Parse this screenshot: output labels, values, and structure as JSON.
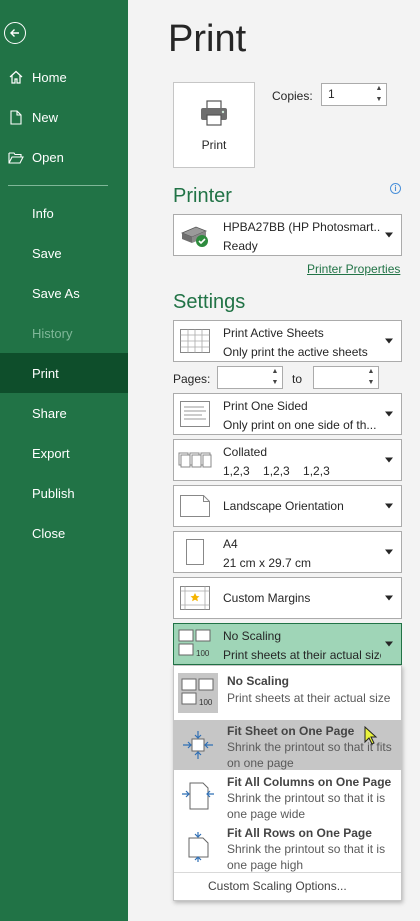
{
  "sidebar": {
    "items": [
      {
        "label": "Home"
      },
      {
        "label": "New"
      },
      {
        "label": "Open"
      },
      {
        "label": "Info"
      },
      {
        "label": "Save"
      },
      {
        "label": "Save As"
      },
      {
        "label": "History"
      },
      {
        "label": "Print"
      },
      {
        "label": "Share"
      },
      {
        "label": "Export"
      },
      {
        "label": "Publish"
      },
      {
        "label": "Close"
      }
    ]
  },
  "main": {
    "title": "Print",
    "print_button": "Print",
    "copies_label": "Copies:",
    "copies_value": "1",
    "printer_heading": "Printer",
    "printer_name": "HPBA27BB (HP Photosmart...",
    "printer_status": "Ready",
    "printer_properties": "Printer Properties",
    "settings_heading": "Settings",
    "pages_label": "Pages:",
    "to_label": "to",
    "settings": [
      {
        "line1": "Print Active Sheets",
        "line2": "Only print the active sheets"
      },
      {
        "line1": "Print One Sided",
        "line2": "Only print on one side of th..."
      },
      {
        "line1": "Collated",
        "line2": "1,2,3    1,2,3    1,2,3"
      },
      {
        "line1": "Landscape Orientation",
        "line2": ""
      },
      {
        "line1": "A4",
        "line2": "21 cm x 29.7 cm"
      },
      {
        "line1": "Custom Margins",
        "line2": ""
      },
      {
        "line1": "No Scaling",
        "line2": "Print sheets at their actual size"
      }
    ]
  },
  "scaling_menu": {
    "options": [
      {
        "title": "No Scaling",
        "desc": "Print sheets at their actual size"
      },
      {
        "title": "Fit Sheet on One Page",
        "desc": "Shrink the printout so that it fits on one page"
      },
      {
        "title": "Fit All Columns on One Page",
        "desc": "Shrink the printout so that it is one page wide"
      },
      {
        "title": "Fit All Rows on One Page",
        "desc": "Shrink the printout so that it is one page high"
      }
    ],
    "custom": "Custom Scaling Options...",
    "icon_badge": "100"
  },
  "colors": {
    "accent": "#217346",
    "active_nav": "#0e4e2b",
    "selected_bg": "#9fd5b7"
  }
}
